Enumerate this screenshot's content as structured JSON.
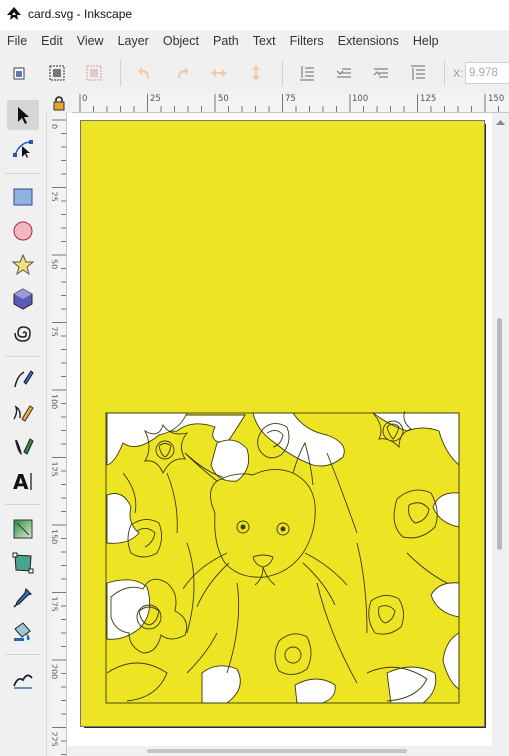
{
  "window": {
    "title": "card.svg - Inkscape"
  },
  "menubar": {
    "items": [
      {
        "label": "File"
      },
      {
        "label": "Edit"
      },
      {
        "label": "View"
      },
      {
        "label": "Layer"
      },
      {
        "label": "Object"
      },
      {
        "label": "Path"
      },
      {
        "label": "Text"
      },
      {
        "label": "Filters"
      },
      {
        "label": "Extensions"
      },
      {
        "label": "Help"
      }
    ]
  },
  "toolbar": {
    "x_label": "X:",
    "x_value": "9.978",
    "buttons": [
      "select-all-icon",
      "select-all-in-all-layers-icon",
      "deselect-icon",
      "rotate-ccw-icon",
      "rotate-cw-icon",
      "flip-horizontal-icon",
      "flip-vertical-icon",
      "lower-to-bottom-icon",
      "lower-icon",
      "raise-icon",
      "raise-to-top-icon"
    ]
  },
  "toolbox": {
    "tools": [
      "selector-tool-icon",
      "node-tool-icon",
      "rectangle-tool-icon",
      "ellipse-tool-icon",
      "star-tool-icon",
      "3d-box-tool-icon",
      "spiral-tool-icon",
      "pen-tool-icon",
      "pencil-tool-icon",
      "calligraphy-tool-icon",
      "text-tool-icon",
      "gradient-tool-icon",
      "mesh-tool-icon",
      "dropper-tool-icon",
      "paint-bucket-tool-icon",
      "tweak-tool-icon"
    ]
  },
  "rulers": {
    "horizontal_labels": [
      "0",
      "25",
      "50",
      "75",
      "100",
      "125",
      "150"
    ],
    "vertical_labels": [
      "0",
      "25",
      "50",
      "75",
      "100",
      "125",
      "150",
      "175",
      "200",
      "225"
    ]
  },
  "colors": {
    "page_fill": "#ede524",
    "line_art": "#3a3a10",
    "cutout": "#ffffff"
  }
}
